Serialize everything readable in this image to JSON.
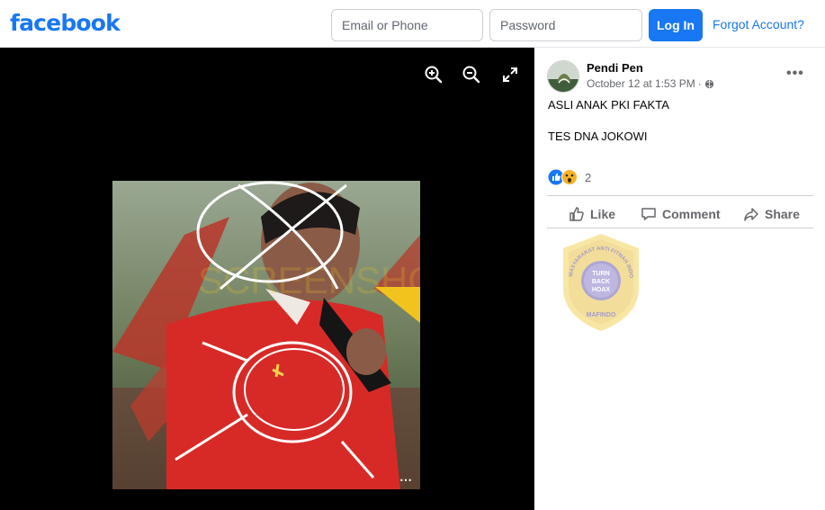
{
  "header": {
    "logo": "facebook",
    "email_placeholder": "Email or Phone",
    "password_placeholder": "Password",
    "login_label": "Log In",
    "forgot_label": "Forgot Account?"
  },
  "viewer": {
    "controls": [
      "zoom-in-icon",
      "zoom-out-icon",
      "fullscreen-icon"
    ],
    "watermark": "SCREENSHOT BY"
  },
  "post": {
    "author": "Pendi Pen",
    "date": "October 12 at 1:53 PM",
    "date_separator": "·",
    "privacy_icon": "globe-icon",
    "line1": "ASLI ANAK PKI FAKTA",
    "line2": "TES DNA JOKOWI",
    "reactions": [
      "like",
      "wow"
    ],
    "reaction_count": "2",
    "actions": {
      "like": "Like",
      "comment": "Comment",
      "share": "Share"
    }
  },
  "stamp": {
    "ring_text": "MASYARAKAT ANTI FITNAH INDONESIA",
    "center_lines": [
      "TURN",
      "BACK",
      "HOAX"
    ],
    "bottom_text": "MAFINDO"
  },
  "colors": {
    "brand_blue": "#1877f2",
    "viewer_bg": "#000000",
    "stamp_gold": "#e8c24a",
    "stamp_purple": "#5b4e9b",
    "like_blue": "#1877f2",
    "wow_yellow": "#f7b125"
  }
}
